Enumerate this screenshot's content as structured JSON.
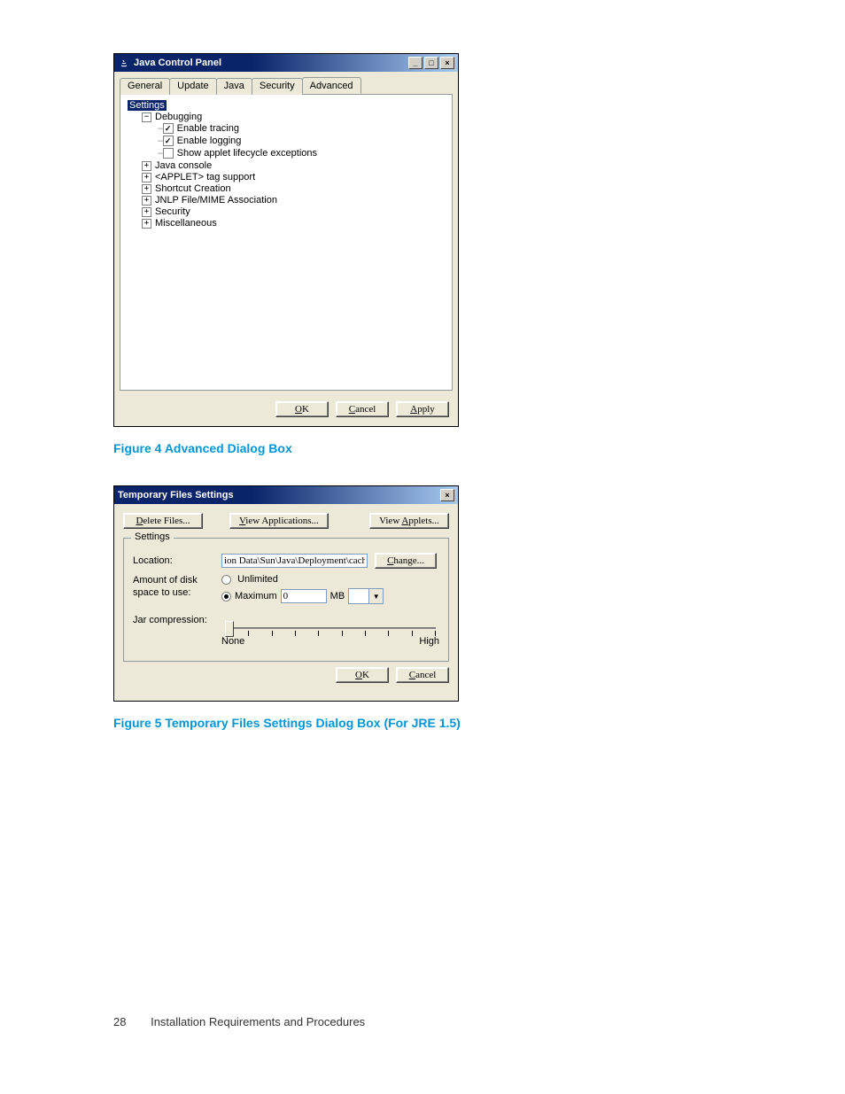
{
  "dialog1": {
    "title": "Java Control Panel",
    "tabs": [
      "General",
      "Update",
      "Java",
      "Security",
      "Advanced"
    ],
    "active_tab": "Advanced",
    "tree": {
      "root": "Settings",
      "debugging": {
        "label": "Debugging",
        "items": [
          {
            "label": "Enable tracing",
            "checked": true
          },
          {
            "label": "Enable logging",
            "checked": true
          },
          {
            "label": "Show applet lifecycle exceptions",
            "checked": false
          }
        ]
      },
      "collapsed": [
        "Java console",
        "<APPLET> tag support",
        "Shortcut Creation",
        "JNLP File/MIME Association",
        "Security",
        "Miscellaneous"
      ]
    },
    "buttons": {
      "ok": "OK",
      "cancel": "Cancel",
      "apply": "Apply"
    }
  },
  "caption1": "Figure 4 Advanced Dialog Box",
  "dialog2": {
    "title": "Temporary Files Settings",
    "top_buttons": {
      "delete": "Delete Files...",
      "view_apps": "View Applications...",
      "view_applets": "View Applets..."
    },
    "group_label": "Settings",
    "location_label": "Location:",
    "location_value": "ion Data\\Sun\\Java\\Deployment\\cache",
    "change": "Change...",
    "disk_label": "Amount of disk space to use:",
    "unlimited": "Unlimited",
    "maximum": "Maximum",
    "maximum_value": "0",
    "unit": "MB",
    "jar_label": "Jar compression:",
    "slider_low": "None",
    "slider_high": "High",
    "buttons": {
      "ok": "OK",
      "cancel": "Cancel"
    }
  },
  "caption2": "Figure 5 Temporary Files Settings Dialog Box (For JRE 1.5)",
  "footer": {
    "page": "28",
    "section": "Installation Requirements and Procedures"
  }
}
